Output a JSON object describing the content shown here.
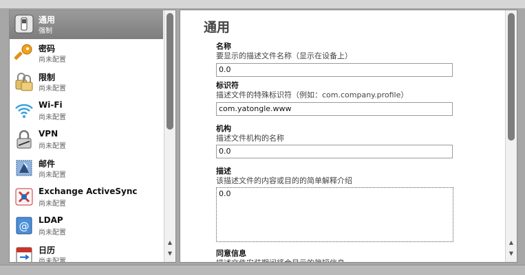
{
  "sidebar": {
    "items": [
      {
        "title": "通用",
        "subtitle": "强制",
        "icon": "switch-icon",
        "selected": true
      },
      {
        "title": "密码",
        "subtitle": "尚未配置",
        "icon": "key-icon"
      },
      {
        "title": "限制",
        "subtitle": "尚未配置",
        "icon": "lock-pair-icon"
      },
      {
        "title": "Wi-Fi",
        "subtitle": "尚未配置",
        "icon": "wifi-icon"
      },
      {
        "title": "VPN",
        "subtitle": "尚未配置",
        "icon": "padlock-icon"
      },
      {
        "title": "邮件",
        "subtitle": "尚未配置",
        "icon": "mail-stamp-icon"
      },
      {
        "title": "Exchange ActiveSync",
        "subtitle": "尚未配置",
        "icon": "exchange-icon"
      },
      {
        "title": "LDAP",
        "subtitle": "尚未配置",
        "icon": "at-sign-icon"
      },
      {
        "title": "日历",
        "subtitle": "尚未配置",
        "icon": "calendar-icon"
      }
    ]
  },
  "main": {
    "title": "通用",
    "fields": {
      "name": {
        "label": "名称",
        "desc": "要显示的描述文件名称（显示在设备上）",
        "value": "0.0"
      },
      "identifier": {
        "label": "标识符",
        "desc": "描述文件的特殊标识符（例如：com.company.profile）",
        "value": "com.yatongle.www"
      },
      "organization": {
        "label": "机构",
        "desc": "描述文件机构的名称",
        "value": "0.0"
      },
      "description": {
        "label": "描述",
        "desc": "该描述文件的内容或目的的简单解释介绍",
        "value": "0.0"
      },
      "consent": {
        "label": "同意信息",
        "desc": "描述文件安装期间将会显示的简短信息"
      }
    }
  },
  "colors": {
    "selected_bg": "#8a8a8a",
    "scroll_thumb": "#7d7d7d"
  }
}
